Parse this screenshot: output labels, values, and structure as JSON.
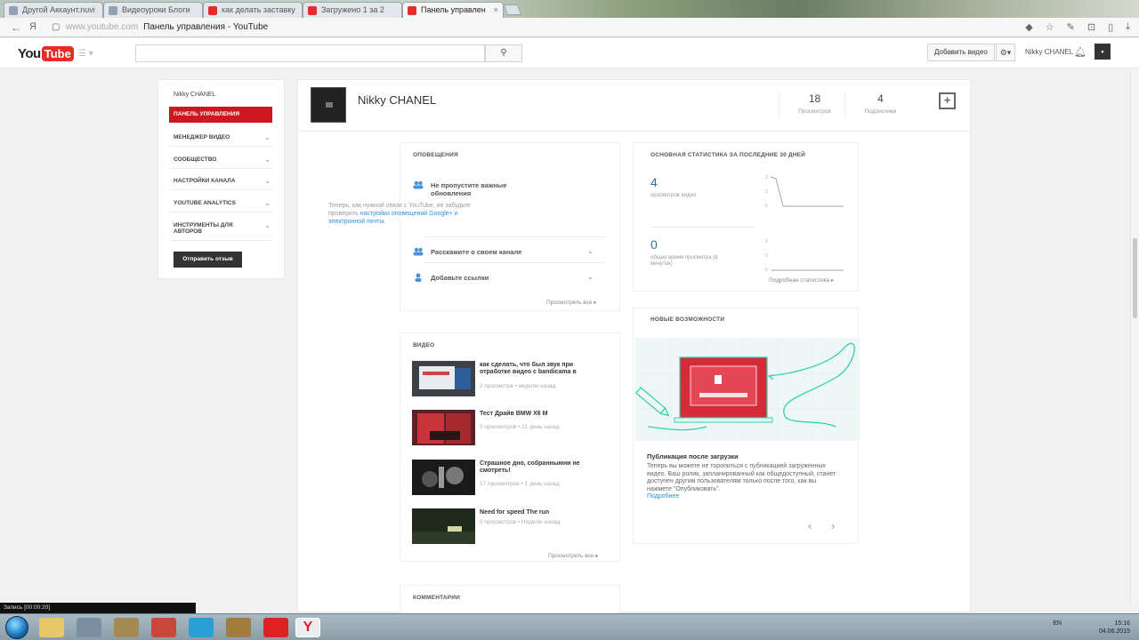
{
  "browser": {
    "tabs": [
      {
        "label": "Другой Аккаунт.nuvi",
        "active": false
      },
      {
        "label": "Видеоуроки Блоги",
        "active": false
      },
      {
        "label": "как делать заставку",
        "active": false
      },
      {
        "label": "Загружено 1 за 2",
        "active": false
      },
      {
        "label": "Панель управлен",
        "active": true
      }
    ],
    "url_host": "www.youtube.com",
    "url_title": "Панель управления - YouTube"
  },
  "header": {
    "logo_you": "You",
    "logo_tube": "Tube",
    "upload_label": "Добавить видео",
    "user_name": "Nikky CHANEL"
  },
  "sidebar": {
    "channel": "Nikky CHANEL",
    "items": [
      {
        "label": "Панель управления",
        "active": true
      },
      {
        "label": "Менеджер видео",
        "active": false
      },
      {
        "label": "Сообщество",
        "active": false
      },
      {
        "label": "Настройки канала",
        "active": false
      },
      {
        "label": "YouTube Analytics",
        "active": false
      },
      {
        "label": "Инструменты для авторов",
        "active": false
      }
    ],
    "feedback_label": "Отправить отзыв"
  },
  "channel": {
    "name": "Nikky CHANEL",
    "views": "18",
    "views_label": "Просмотров",
    "subs": "4",
    "subs_label": "Подписчики"
  },
  "notifications": {
    "title": "Оповещения",
    "items": [
      {
        "title": "Не пропустите важные обновления"
      },
      {
        "title": "Расскажите о своем канале"
      },
      {
        "title": "Добавьте ссылки"
      }
    ],
    "body_text": "Теперь, как нужной связи с YouTube, не забудьте проверить",
    "body_link": "настройки оповещений Google+ и электронной почты.",
    "more": "Просмотреть все"
  },
  "stats": {
    "title": "Основная статистика за последние 30 дней",
    "views_value": "4",
    "views_label": "просмотров видео",
    "time_value": "0",
    "time_label": "общее время просмотра (в минутах)",
    "more": "Подробная статистика"
  },
  "new_features": {
    "title": "Новые возможности",
    "heading": "Публикация после загрузки",
    "text": "Теперь вы можете не торопиться с публикацией загруженных видео. Ваш ролик, запланированный как общедоступный, станет доступен другим пользователям только после того, как вы нажмете \"Опубликовать\".",
    "link": "Подробнее"
  },
  "videos": {
    "title": "Видео",
    "items": [
      {
        "title": "как сделать, что был звук при отработке видео с bandicama в",
        "meta": "2 просмотра • неделю назад"
      },
      {
        "title": "Тест Драйв BMW X6 M",
        "meta": "0 просмотров • 21 день назад"
      },
      {
        "title": "Страшное дно, собраннымни не смотреть!",
        "meta": "17 просмотров • 1 день назад"
      },
      {
        "title": "Need for speed The run",
        "meta": "0 просмотров • Неделю назад"
      }
    ],
    "more": "Просмотреть все"
  },
  "comments": {
    "title": "Комментарии"
  },
  "taskbar": {
    "rec_text": "Запись [00:00:20]",
    "clock_time": "15:16",
    "clock_date": "04.06.2015",
    "lang": "EN"
  },
  "colors": {
    "brand_red": "#cc181e",
    "link_blue": "#2793e6",
    "illustration_teal": "#2fd3ad"
  }
}
